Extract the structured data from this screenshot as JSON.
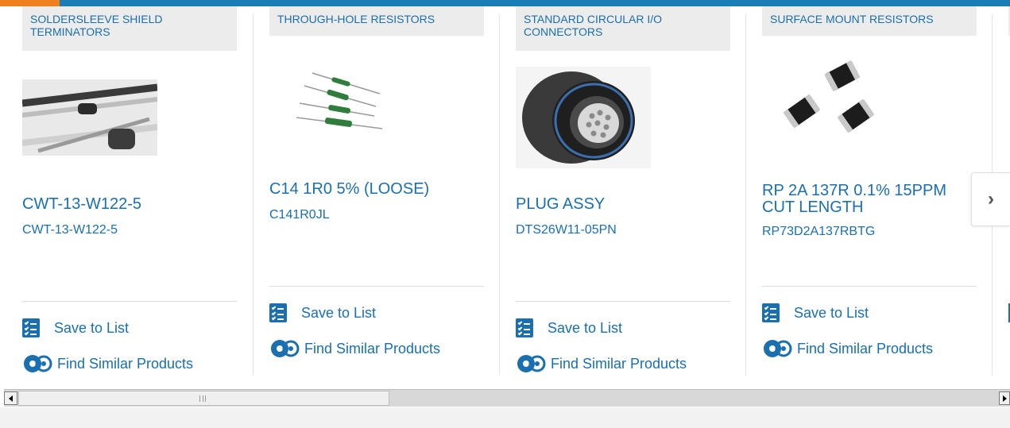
{
  "cards": [
    {
      "category": "SOLDERSLEEVE SHIELD TERMINATORS",
      "title": "CWT-13-W122-5",
      "part_number": "CWT-13-W122-5",
      "image_icon": "soldersleeve-photo",
      "save_label": "Save to List",
      "similar_label": "Find Similar Products"
    },
    {
      "category": "THROUGH-HOLE RESISTORS",
      "title": "C14 1R0 5% (LOOSE)",
      "part_number": "C141R0JL",
      "image_icon": "resistor-photo",
      "save_label": "Save to List",
      "similar_label": "Find Similar Products"
    },
    {
      "category": "STANDARD CIRCULAR I/O CONNECTORS",
      "title": "PLUG ASSY",
      "part_number": "DTS26W11-05PN",
      "image_icon": "connector-photo",
      "save_label": "Save to List",
      "similar_label": "Find Similar Products"
    },
    {
      "category": "SURFACE MOUNT RESISTORS",
      "title": "RP 2A 137R 0.1% 15PPM CUT LENGTH",
      "part_number": "RP73D2A137RBTG",
      "image_icon": "smd-resistor-photo",
      "save_label": "Save to List",
      "similar_label": "Find Similar Products"
    }
  ],
  "carousel": {
    "next_icon": "chevron-right-icon",
    "next_glyph": "›"
  },
  "scrollbar": {
    "left_icon": "scroll-left-arrow-icon",
    "right_icon": "scroll-right-arrow-icon"
  },
  "colors": {
    "brand_blue": "#1a6fb0",
    "top_bar": "#1a7db6",
    "top_accent": "#f07f1e",
    "category_bg": "#ececec"
  }
}
